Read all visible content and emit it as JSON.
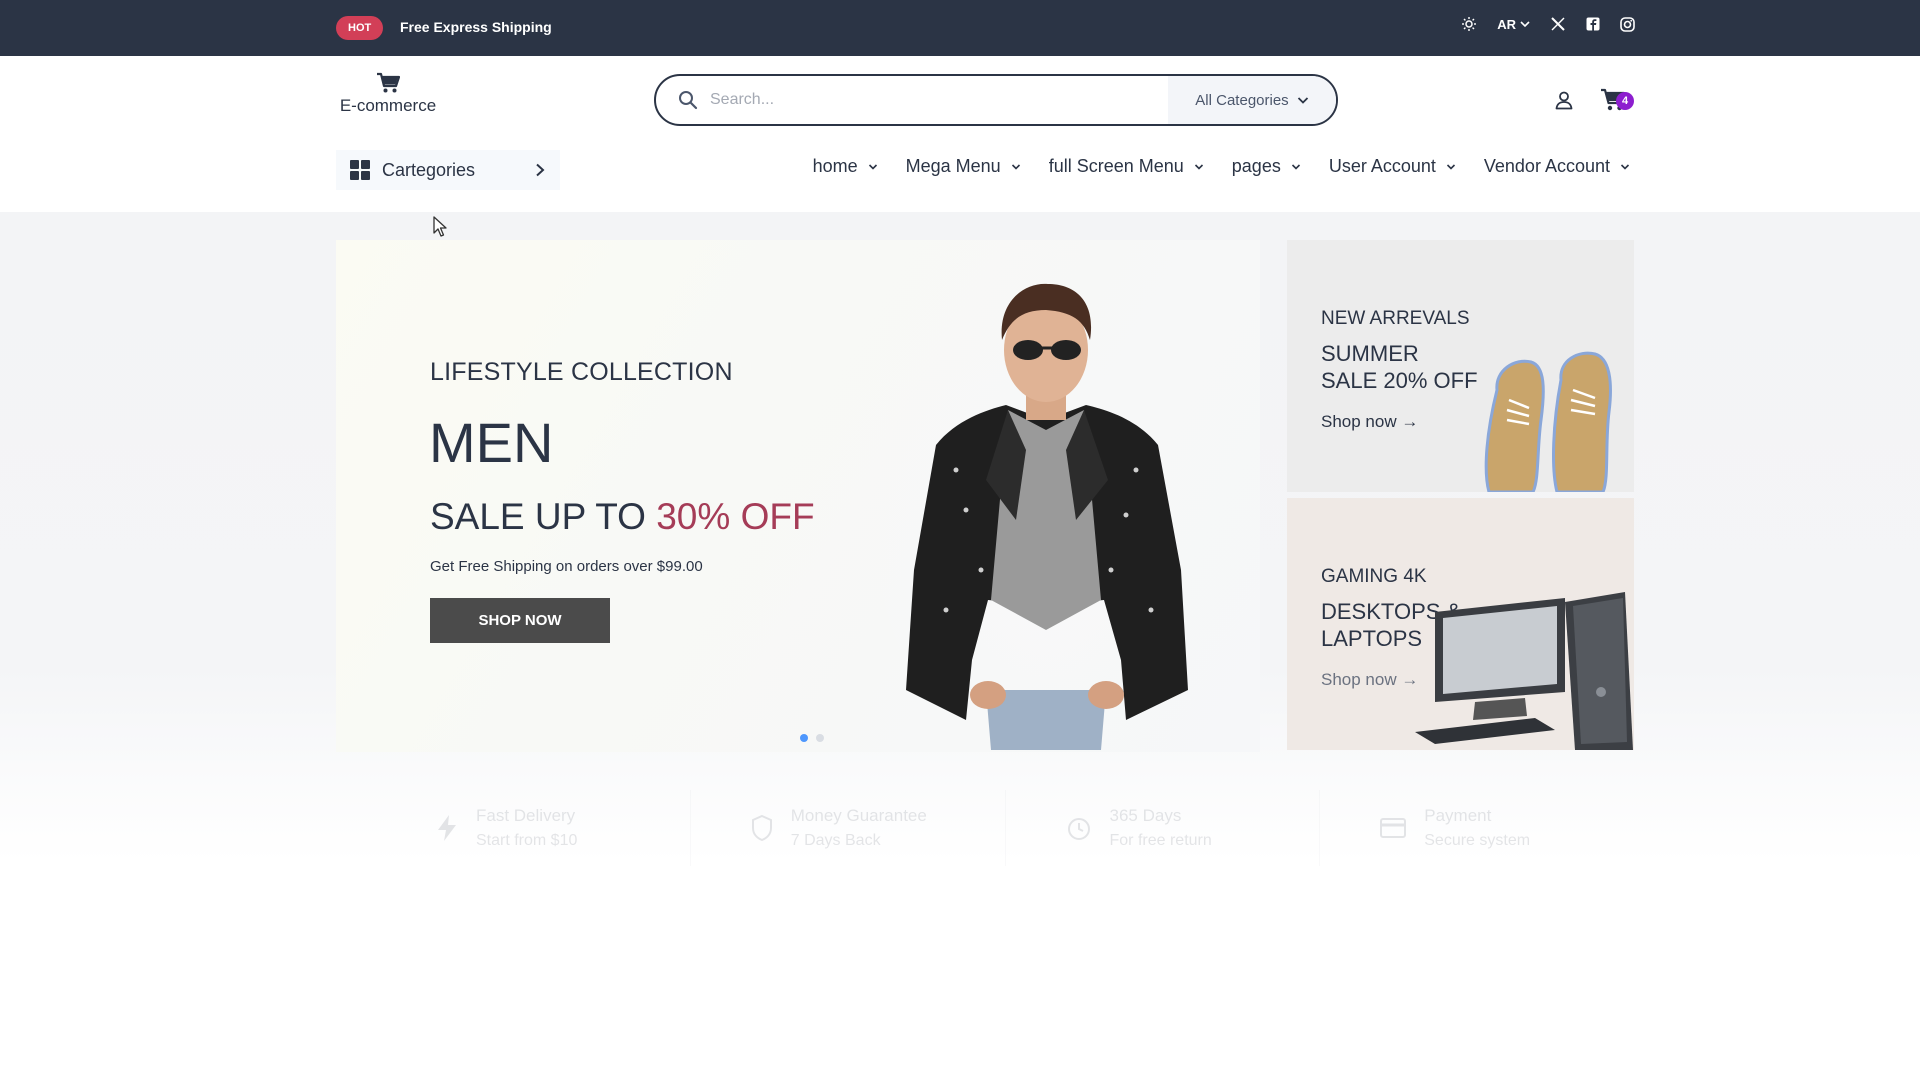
{
  "topbar": {
    "hot_badge": "HOT",
    "shipping_text": "Free Express Shipping",
    "language": "AR"
  },
  "header": {
    "logo_text": "E-commerce",
    "search_placeholder": "Search...",
    "category_select": "All Categories",
    "cart_count": "4"
  },
  "nav": {
    "categories_label": "Cartegories",
    "items": [
      "home",
      "Mega Menu",
      "full Screen Menu",
      "pages",
      "User Account",
      "Vendor Account"
    ]
  },
  "hero": {
    "subtitle": "LIFESTYLE COLLECTION",
    "title": "MEN",
    "sale_prefix": "SALE UP TO ",
    "sale_percent": "30% OFF",
    "description": "Get Free Shipping on orders over $99.00",
    "button": "SHOP NOW",
    "active_slide": 1,
    "slide_count": 2
  },
  "promos": [
    {
      "kicker": "NEW ARREVALS",
      "line1": "SUMMER",
      "line2": "SALE 20% OFF",
      "link": "Shop now →"
    },
    {
      "kicker": "GAMING 4K",
      "line1": "DESKTOPS &",
      "line2": "LAPTOPS",
      "link": "Shop now →"
    }
  ],
  "services": [
    {
      "title": "Fast Delivery",
      "subtitle": "Start from $10"
    },
    {
      "title": "Money Guarantee",
      "subtitle": "7 Days Back"
    },
    {
      "title": "365 Days",
      "subtitle": "For free return"
    },
    {
      "title": "Payment",
      "subtitle": "Secure system"
    }
  ],
  "colors": {
    "topbar": "#2b3445",
    "hot": "#d23f57",
    "sale_accent": "#a53c57",
    "cart_badge": "#8d1ecf",
    "active_dot": "#4e97fd"
  }
}
